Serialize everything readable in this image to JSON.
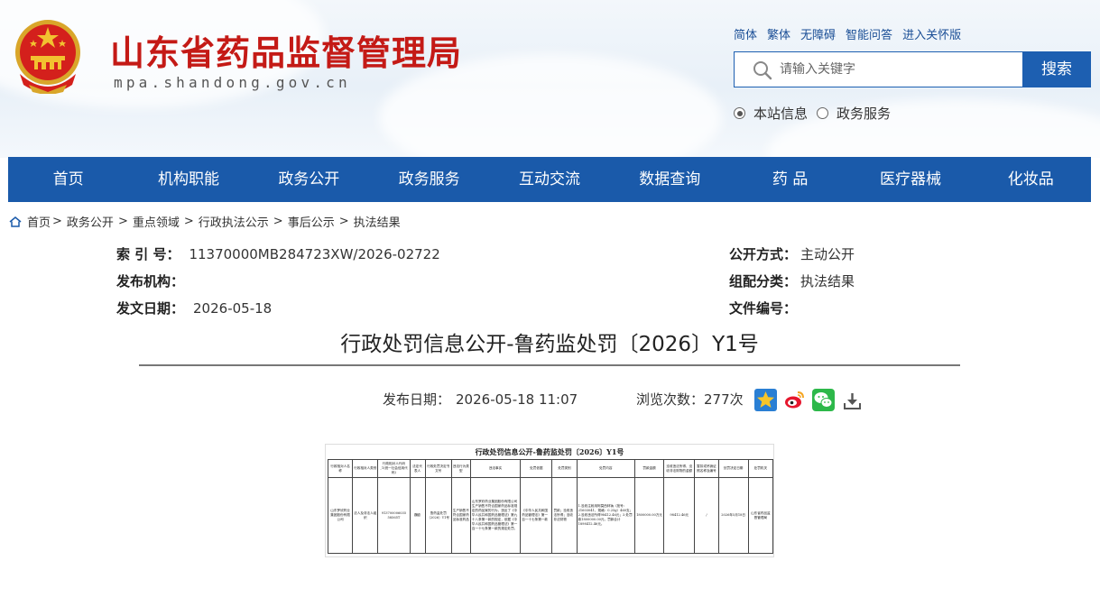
{
  "header": {
    "site_title": "山东省药品监督管理局",
    "site_domain": "mpa.shandong.gov.cn",
    "top_links": [
      "简体",
      "繁体",
      "无障碍",
      "智能问答",
      "进入关怀版"
    ],
    "search": {
      "placeholder": "请输入关键字",
      "button_label": "搜索"
    },
    "radios": [
      {
        "label": "本站信息",
        "checked": true
      },
      {
        "label": "政务服务",
        "checked": false
      }
    ],
    "colors": {
      "brand_red": "#c41a16",
      "nav_blue": "#1a5aaa"
    }
  },
  "nav": {
    "items": [
      "首页",
      "机构职能",
      "政务公开",
      "政务服务",
      "互动交流",
      "数据查询",
      "药 品",
      "医疗器械",
      "化妆品"
    ]
  },
  "breadcrumb": {
    "items": [
      "首页",
      "政务公开",
      "重点领域",
      "行政执法公示",
      "事后公示",
      "执法结果"
    ],
    "separator": ">"
  },
  "meta": {
    "index_label": "索 引 号：",
    "index_value": "11370000MB284723XW/2026-02722",
    "public_label": "公开方式：",
    "public_value": "主动公开",
    "publisher_label": "发布机构：",
    "publisher_value": "",
    "category_label": "组配分类：",
    "category_value": "执法结果",
    "date_label": "发文日期：",
    "date_value": "2026-05-18",
    "docno_label": "文件编号：",
    "docno_value": ""
  },
  "article": {
    "title": "行政处罚信息公开-鲁药监处罚〔2026〕Y1号",
    "pub_label": "发布日期：",
    "pub_value": "2026-05-18 11:07",
    "views_label": "浏览次数：",
    "views_value": "277次",
    "share_icons": [
      "favorite-star-icon",
      "weibo-icon",
      "wechat-icon",
      "download-icon"
    ]
  },
  "document": {
    "title": "行政处罚信息公开-鲁药监处罚〔2026〕Y1号",
    "headers": [
      "行政相对人名称",
      "行政相对人类别",
      "行政相对人代码_1(统一社会信用代码)",
      "法定代表人",
      "行政处罚决定书文号",
      "违法行为类型",
      "违法事实",
      "处罚依据",
      "处罚类别",
      "处罚内容",
      "罚款金额",
      "没收违法所得、没收非法财物的金额",
      "暂扣或吊销证照名称及编号",
      "处罚决定日期",
      "处罚机关"
    ],
    "row": [
      "山东罗欣药业集团股份有限公司",
      "法人及非法人组织",
      "913700006035 58565T",
      "魏欧",
      "鲁药监处罚〔2026〕Y1号",
      "生产销售不符合国家药品标准药品",
      "山东罗欣药业集团股份有限公司生产销售不符合国家药品标准规定的药品案的行为，违反了《中华人民共和国药品管理法》第九十八条第一款的规定，依据《中华人民共和国药品管理法》第一百一十七条第一款的规定处罚。",
      "《中华人民共和国药品管理法》第一百一十七条第一款",
      "罚款；没收违法所得；没收非法财物",
      "1.没收注射用阿莫西林钠（批号：21603041，规格：0.25g）460支；2.没收违法所得98412.46元；3.处罚款1800000.00元，罚款合计1898412.46元。",
      "1800000.00万元",
      "98412.46元",
      "/",
      "2026年5月18日",
      "山东省药品监督管理局"
    ]
  }
}
